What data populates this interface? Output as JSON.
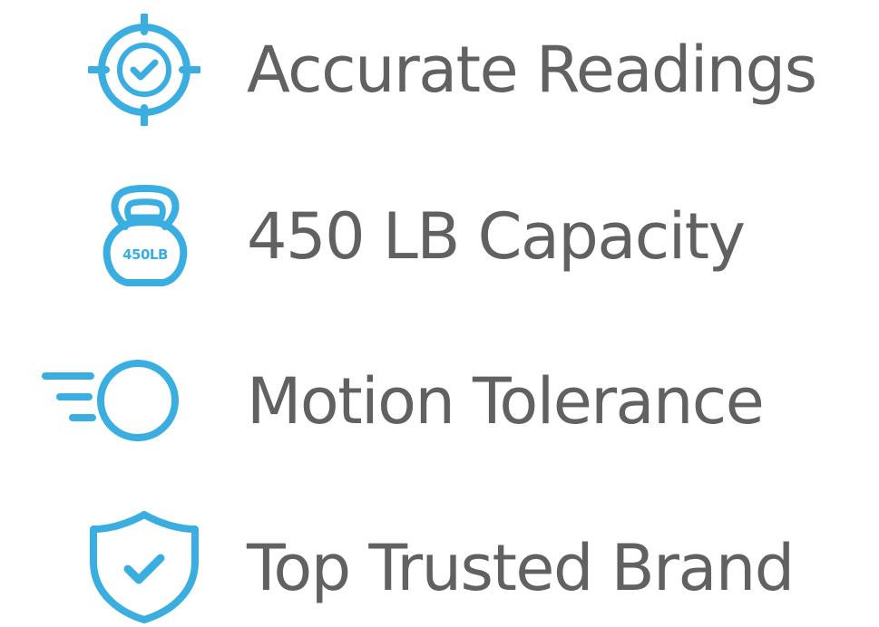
{
  "features": [
    {
      "icon": "target-check-icon",
      "label": "Accurate Readings"
    },
    {
      "icon": "kettlebell-icon",
      "label": "450 LB Capacity",
      "icon_text": "450LB"
    },
    {
      "icon": "motion-circle-icon",
      "label": "Motion Tolerance"
    },
    {
      "icon": "shield-check-icon",
      "label": "Top Trusted Brand"
    }
  ],
  "colors": {
    "icon": "#3aaee0",
    "text": "#616161",
    "background": "#ffffff"
  }
}
